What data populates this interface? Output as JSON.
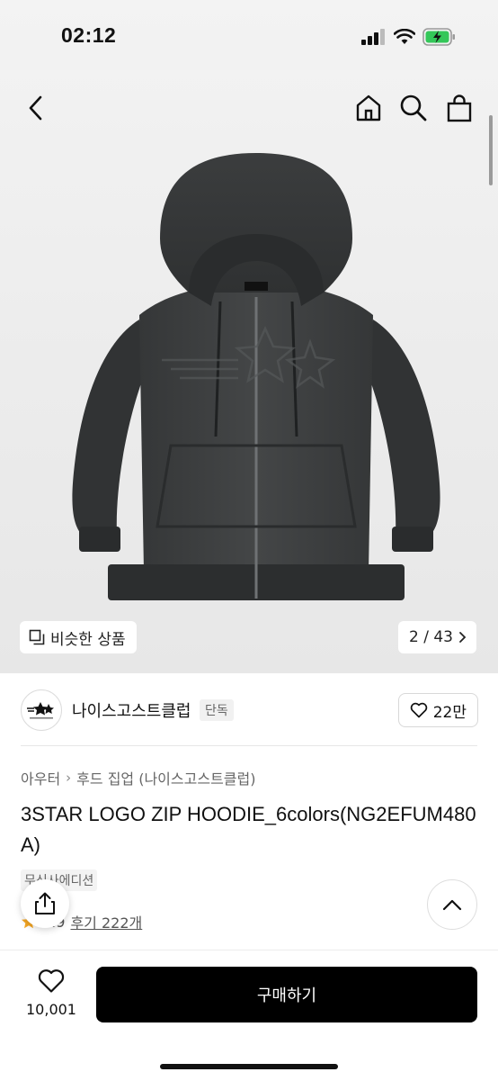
{
  "status_bar": {
    "time": "02:12"
  },
  "header": {
    "back_icon": "chevron-left-icon",
    "home_icon": "home-icon",
    "search_icon": "search-icon",
    "cart_icon": "shopping-bag-icon"
  },
  "gallery": {
    "similar_label": "비슷한 상품",
    "counter": "2 / 43"
  },
  "brand": {
    "name": "나이스고스트클럽",
    "badge": "단독",
    "likes": "22만"
  },
  "product": {
    "breadcrumb": [
      "아우터",
      "후드 집업 (나이스고스트클럽)"
    ],
    "title": "3STAR LOGO ZIP HOODIE_6colors(NG2EFUM480A)",
    "edition": "무신사에디션",
    "rating": "4.9",
    "reviews": "후기 222개"
  },
  "bottom_bar": {
    "wish_count": "10,001",
    "buy_label": "구매하기"
  },
  "colors": {
    "buy_button": "#000000",
    "accent_star": "#f5a623"
  }
}
